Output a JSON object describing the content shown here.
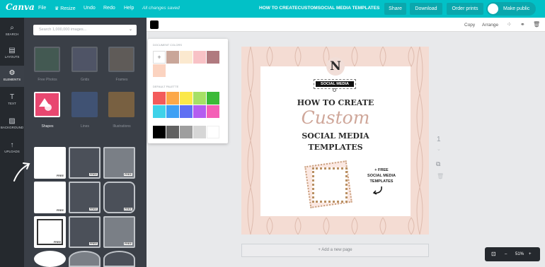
{
  "topbar": {
    "logo": "Canva",
    "file": "File",
    "resize": "Resize",
    "undo": "Undo",
    "redo": "Redo",
    "help": "Help",
    "saved_status": "All changes saved",
    "doc_title": "HOW TO CREATECUSTOMSOCIAL MEDIA TEMPLATES",
    "share": "Share",
    "download": "Download",
    "order_prints": "Order prints",
    "make_public": "Make public"
  },
  "leftnav": [
    {
      "label": "Search",
      "icon": "search-icon"
    },
    {
      "label": "Layouts",
      "icon": "layouts-icon"
    },
    {
      "label": "Elements",
      "icon": "elements-icon"
    },
    {
      "label": "Text",
      "icon": "text-icon"
    },
    {
      "label": "Background",
      "icon": "background-icon"
    },
    {
      "label": "Uploads",
      "icon": "uploads-icon"
    }
  ],
  "panel": {
    "search_placeholder": "Search 1,000,000 images...",
    "categories": [
      {
        "label": "Free Photos"
      },
      {
        "label": "Grids"
      },
      {
        "label": "Frames"
      },
      {
        "label": "Shapes"
      },
      {
        "label": "Lines"
      },
      {
        "label": "Illustrations"
      }
    ],
    "free_badge": "FREE"
  },
  "colorpicker": {
    "document_colors_title": "DOCUMENT COLORS",
    "add_symbol": "+",
    "document_colors": [
      "#c9a699",
      "#fbe9cf",
      "#f8c2c6",
      "#b07a7f",
      "#fbd3c0"
    ],
    "default_palette_title": "DEFAULT PALETTE",
    "default_palette": [
      "#f35b5b",
      "#fca848",
      "#fbe84a",
      "#a6e066",
      "#3bba38",
      "#3fd2e9",
      "#3ea0f4",
      "#6070f3",
      "#b45df0",
      "#f45fb6",
      "#000000",
      "#616161",
      "#9e9e9e",
      "#d6d6d6",
      "#ffffff"
    ]
  },
  "subtoolbar": {
    "current_color": "#000000",
    "copy": "Copy",
    "arrange": "Arrange"
  },
  "design": {
    "monogram": "N",
    "social_media_label": "SOCIAL MEDIA",
    "line1": "HOW TO CREATE",
    "line2": "Custom",
    "line3": "SOCIAL MEDIA",
    "line4": "TEMPLATES",
    "promo1": "+ FREE",
    "promo2": "SOCIAL MEDIA",
    "promo3": "TEMPLATES"
  },
  "page_number": "1",
  "add_page": "+ Add a new page",
  "zoom": "51%",
  "colors": {
    "brand": "#02c1c7",
    "button": "#0aa7ad",
    "nav_bg": "#25292e",
    "panel_bg": "#3a3f47"
  }
}
